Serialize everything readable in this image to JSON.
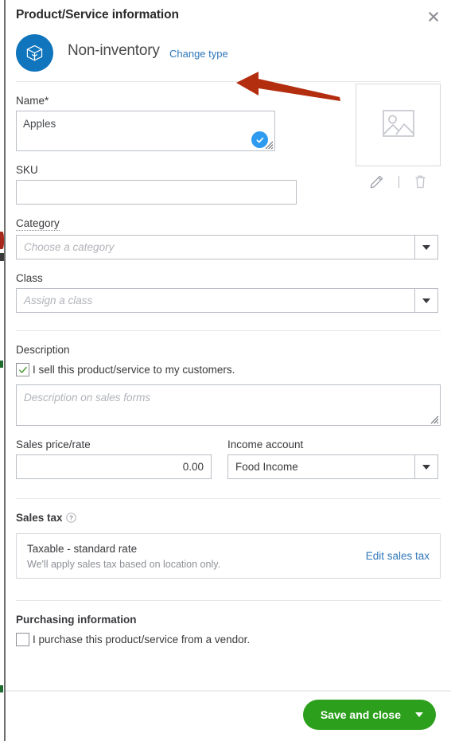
{
  "header": {
    "title": "Product/Service information",
    "close_icon": "close-icon"
  },
  "type_row": {
    "icon": "open-box-icon",
    "type_name": "Non-inventory",
    "change_type_link": "Change type",
    "annotation_icon": "red-arrow-pointing-left"
  },
  "name": {
    "label": "Name*",
    "value": "Apples",
    "valid_icon": "check-circle-icon",
    "resize_icon": "resize-grip-icon"
  },
  "image": {
    "placeholder_icon": "image-placeholder-icon",
    "edit_icon": "pencil-icon",
    "delete_icon": "trash-icon"
  },
  "sku": {
    "label": "SKU",
    "value": "",
    "placeholder": ""
  },
  "category": {
    "label": "Category",
    "value": "",
    "placeholder": "Choose a category",
    "caret_icon": "chevron-down-icon"
  },
  "class": {
    "label": "Class",
    "value": "",
    "placeholder": "Assign a class",
    "caret_icon": "chevron-down-icon"
  },
  "description": {
    "label": "Description",
    "sell_checkbox_label": "I sell this product/service to my customers.",
    "sell_checked": true,
    "placeholder": "Description on sales forms",
    "value": ""
  },
  "sales_price": {
    "label": "Sales price/rate",
    "value": "0.00"
  },
  "income_account": {
    "label": "Income account",
    "value": "Food Income",
    "caret_icon": "chevron-down-icon"
  },
  "sales_tax": {
    "label": "Sales tax",
    "help_icon": "question-circle-icon",
    "title": "Taxable - standard rate",
    "subtitle": "We'll apply sales tax based on location only.",
    "edit_link": "Edit sales tax"
  },
  "purchasing": {
    "label": "Purchasing information",
    "purchase_checkbox_label": "I purchase this product/service from a vendor.",
    "purchase_checked": false
  },
  "footer": {
    "save_label": "Save and close",
    "save_caret_icon": "chevron-down-icon"
  },
  "colors": {
    "brand_blue": "#1075bd",
    "link_blue": "#2f77b8",
    "valid_blue": "#2e9bf0",
    "save_green": "#2ca01c",
    "check_green": "#4d9f3c",
    "arrow_red": "#b32d0f"
  }
}
